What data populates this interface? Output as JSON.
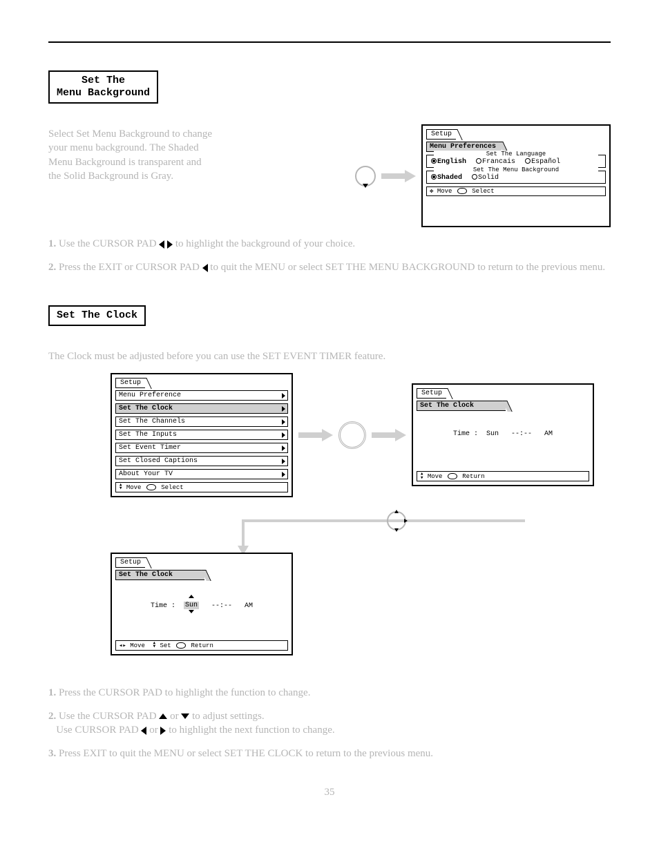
{
  "section1": {
    "title_line1": "Set The",
    "title_line2": "Menu Background",
    "intro": "Select Set Menu Background to change your menu background. The Shaded Menu Background is transparent and the Solid Background is Gray.",
    "step1_prefix": "Use the CURSOR PAD",
    "step1_suffix": "to highlight the background of your choice.",
    "step2_prefix": "Press the EXIT or CURSOR PAD",
    "step2_suffix": "to quit the MENU or select SET THE MENU BACKGROUND to return to the previous menu."
  },
  "osd_prefs": {
    "tab": "Setup",
    "breadcrumb": "Menu Preferences",
    "lang_legend": "Set The Language",
    "lang_options": [
      {
        "label": "English",
        "selected": true
      },
      {
        "label": "Francais",
        "selected": false
      },
      {
        "label": "Español",
        "selected": false
      }
    ],
    "bg_legend": "Set The Menu Background",
    "bg_options": [
      {
        "label": "Shaded",
        "selected": true
      },
      {
        "label": "Solid",
        "selected": false
      }
    ],
    "hint_move": "Move",
    "hint_select": "Select"
  },
  "section2": {
    "title": "Set The Clock",
    "intro": "The Clock must be adjusted before you can use the SET EVENT TIMER feature.",
    "step1": "Press the CURSOR PAD to highlight the function to change.",
    "step2_prefix": "Use the CURSOR PAD",
    "step2_mid1": "or",
    "step2_mid2": "to adjust settings.",
    "step2_prefix2": "Use CURSOR PAD",
    "step2_mid3": "or",
    "step2_suffix": "to highlight the next function to change.",
    "step3": "Press EXIT to quit the MENU or select SET THE CLOCK to return to the previous menu."
  },
  "osd_setup_list": {
    "tab": "Setup",
    "items": [
      {
        "label": "Menu Preference",
        "active": false
      },
      {
        "label": "Set The Clock",
        "active": true
      },
      {
        "label": "Set The Channels",
        "active": false
      },
      {
        "label": "Set The Inputs",
        "active": false
      },
      {
        "label": "Set Event Timer",
        "active": false
      },
      {
        "label": "Set Closed Captions",
        "active": false
      },
      {
        "label": "About Your TV",
        "active": false
      }
    ],
    "hint_move": "Move",
    "hint_select": "Select"
  },
  "osd_clock1": {
    "tab": "Setup",
    "breadcrumb": "Set The Clock",
    "time_label": "Time :",
    "day": "Sun",
    "time": "--:--",
    "ampm": "AM",
    "hint_move": "Move",
    "hint_return": "Return"
  },
  "osd_clock2": {
    "tab": "Setup",
    "breadcrumb": "Set The Clock",
    "time_label": "Time :",
    "day": "Sun",
    "time": "--:--",
    "ampm": "AM",
    "hint_move": "Move",
    "hint_set": "Set",
    "hint_return": "Return"
  },
  "page_number": "35"
}
